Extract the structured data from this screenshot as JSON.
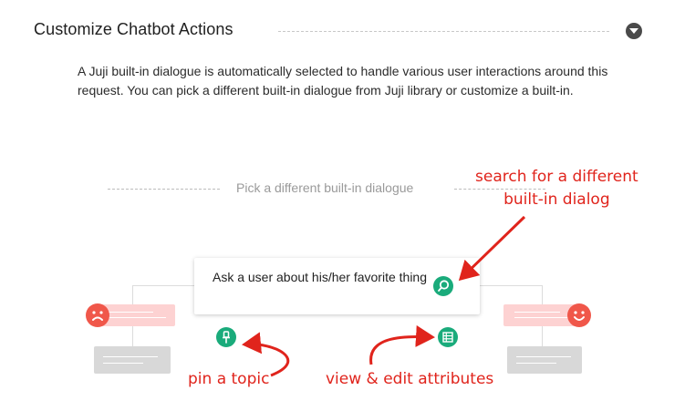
{
  "section": {
    "title": "Customize Chatbot Actions",
    "collapse_icon": "chevron-down-circle-icon"
  },
  "description": "A Juji built-in dialogue is automatically selected to handle various user interactions around this request. You can pick a different built-in dialogue from Juji library or customize a built-in.",
  "picker": {
    "label": "Pick a different built-in dialogue"
  },
  "dialog_card": {
    "text": "Ask a user about his/her favorite thing",
    "search_icon": "search-icon",
    "pin_icon": "pin-icon",
    "attributes_icon": "table-icon"
  },
  "annotations": {
    "search_line1": "search for a different",
    "search_line2": "built-in dialog",
    "pin": "pin a topic",
    "view_edit": "view & edit attributes"
  },
  "colors": {
    "accent_green": "#1aab7b",
    "annotation_red": "#e0241c",
    "sad_face": "#f0574a",
    "happy_face": "#f0574a"
  }
}
